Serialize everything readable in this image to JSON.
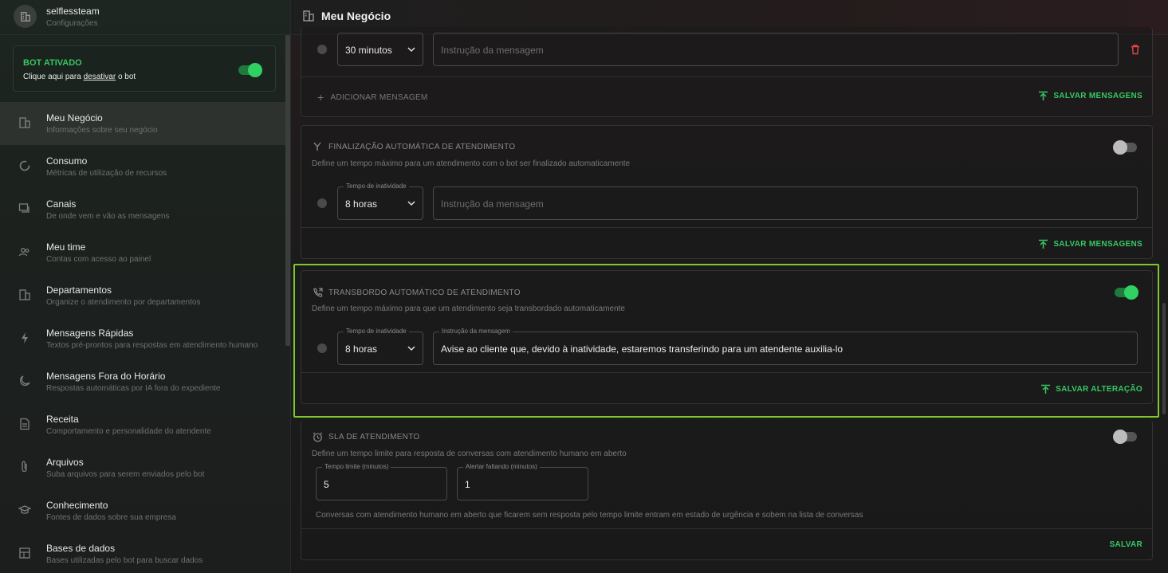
{
  "org": {
    "name": "selflessteam",
    "subtitle": "Configurações"
  },
  "bot": {
    "title": "BOT ATIVADO",
    "desc_prefix": "Clique aqui para ",
    "desc_link": "desativar",
    "desc_suffix": " o bot",
    "enabled": true
  },
  "sidebar": {
    "items": [
      {
        "label": "Meu Negócio",
        "desc": "Informações sobre seu negócio",
        "icon": "building-icon",
        "active": true
      },
      {
        "label": "Consumo",
        "desc": "Métricas de utilização de recursos",
        "icon": "donut-icon"
      },
      {
        "label": "Canais",
        "desc": "De onde vem e vão as mensagens",
        "icon": "chat-icon"
      },
      {
        "label": "Meu time",
        "desc": "Contas com acesso ao painel",
        "icon": "team-icon"
      },
      {
        "label": "Departamentos",
        "desc": "Organize o atendimento por departamentos",
        "icon": "building-icon"
      },
      {
        "label": "Mensagens Rápidas",
        "desc": "Textos pré-prontos para respostas em atendimento humano",
        "icon": "bolt-icon"
      },
      {
        "label": "Mensagens Fora do Horário",
        "desc": "Respostas automáticas por IA fora do expediente",
        "icon": "moon-icon"
      },
      {
        "label": "Receita",
        "desc": "Comportamento e personalidade do atendente",
        "icon": "document-icon"
      },
      {
        "label": "Arquivos",
        "desc": "Suba arquivos para serem enviados pelo bot",
        "icon": "paperclip-icon"
      },
      {
        "label": "Conhecimento",
        "desc": "Fontes de dados sobre sua empresa",
        "icon": "graduation-icon"
      },
      {
        "label": "Bases de dados",
        "desc": "Bases utilizadas pelo bot para buscar dados",
        "icon": "database-icon"
      }
    ]
  },
  "header": {
    "title": "Meu Negócio"
  },
  "card_messages": {
    "select_value": "30 minutos",
    "input_placeholder": "Instrução da mensagem",
    "add_label": "ADICIONAR MENSAGEM",
    "save_label": "SALVAR MENSAGENS"
  },
  "card_finalizacao": {
    "title": "FINALIZAÇÃO AUTOMÁTICA DE ATENDIMENTO",
    "desc": "Define um tempo máximo para um atendimento com o bot ser finalizado automaticamente",
    "enabled": false,
    "select_label": "Tempo de inatividade",
    "select_value": "8 horas",
    "input_placeholder": "Instrução da mensagem",
    "save_label": "SALVAR MENSAGENS"
  },
  "card_transbordo": {
    "title": "TRANSBORDO AUTOMÁTICO DE ATENDIMENTO",
    "desc": "Define um tempo máximo para que um atendimento seja transbordado automaticamente",
    "enabled": true,
    "select_label": "Tempo de inatividade",
    "select_value": "8 horas",
    "input_label": "Instrução da mensagem",
    "input_value": "Avise ao cliente que, devido à inatividade, estaremos transferindo para um atendente auxilia-lo",
    "save_label": "SALVAR ALTERAÇÃO"
  },
  "card_sla": {
    "title": "SLA DE ATENDIMENTO",
    "desc": "Define um tempo limite para resposta de conversas com atendimento humano em aberto",
    "enabled": false,
    "limit_label": "Tempo limite (minutos)",
    "limit_value": "5",
    "alert_label": "Alertar faltando (minutos)",
    "alert_value": "1",
    "note": "Conversas com atendimento humano em aberto que ficarem sem resposta pelo tempo limite entram em estado de urgência e sobem na lista de conversas",
    "save_label": "SALVAR"
  },
  "colors": {
    "accent": "#37c764",
    "highlight": "#7ec92a",
    "danger": "#e0464b"
  }
}
